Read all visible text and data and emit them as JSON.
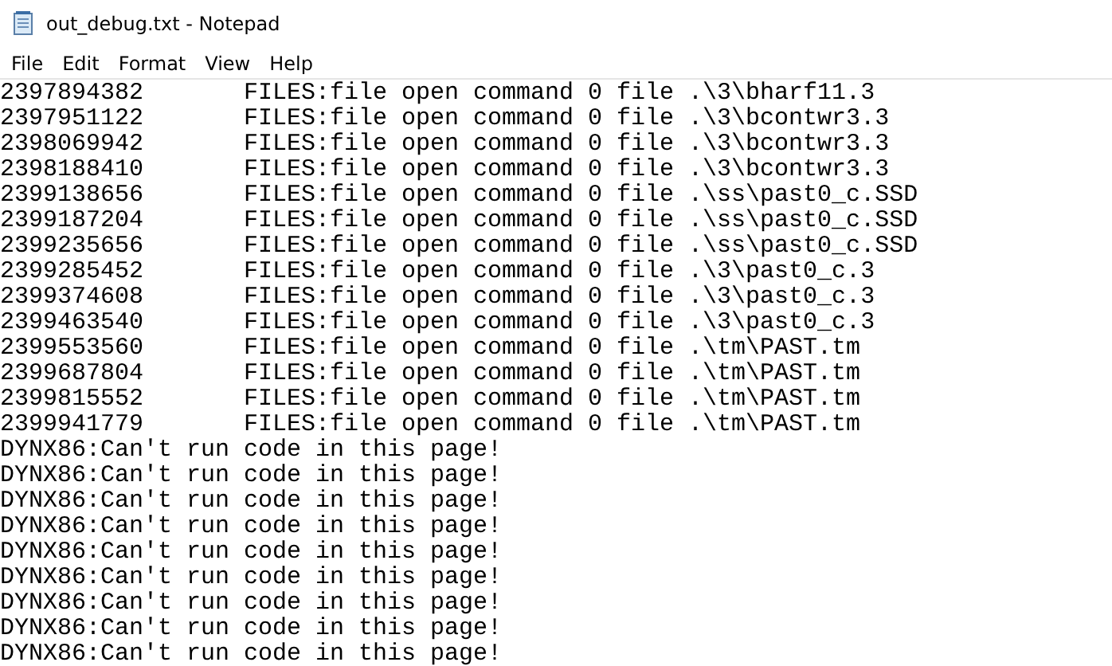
{
  "window": {
    "title": "out_debug.txt - Notepad"
  },
  "menu": [
    "File",
    "Edit",
    "Format",
    "View",
    "Help"
  ],
  "lines": [
    {
      "time": "2397894382",
      "text": "FILES:file open command 0 file .\\3\\bharf11.3"
    },
    {
      "time": "2397951122",
      "text": "FILES:file open command 0 file .\\3\\bcontwr3.3"
    },
    {
      "time": "2398069942",
      "text": "FILES:file open command 0 file .\\3\\bcontwr3.3"
    },
    {
      "time": "2398188410",
      "text": "FILES:file open command 0 file .\\3\\bcontwr3.3"
    },
    {
      "time": "2399138656",
      "text": "FILES:file open command 0 file .\\ss\\past0_c.SSD"
    },
    {
      "time": "2399187204",
      "text": "FILES:file open command 0 file .\\ss\\past0_c.SSD"
    },
    {
      "time": "2399235656",
      "text": "FILES:file open command 0 file .\\ss\\past0_c.SSD"
    },
    {
      "time": "2399285452",
      "text": "FILES:file open command 0 file .\\3\\past0_c.3"
    },
    {
      "time": "2399374608",
      "text": "FILES:file open command 0 file .\\3\\past0_c.3"
    },
    {
      "time": "2399463540",
      "text": "FILES:file open command 0 file .\\3\\past0_c.3"
    },
    {
      "time": "2399553560",
      "text": "FILES:file open command 0 file .\\tm\\PAST.tm"
    },
    {
      "time": "2399687804",
      "text": "FILES:file open command 0 file .\\tm\\PAST.tm"
    },
    {
      "time": "2399815552",
      "text": "FILES:file open command 0 file .\\tm\\PAST.tm"
    },
    {
      "time": "2399941779",
      "text": "FILES:file open command 0 file .\\tm\\PAST.tm"
    },
    {
      "text": "DYNX86:Can't run code in this page!"
    },
    {
      "text": "DYNX86:Can't run code in this page!"
    },
    {
      "text": "DYNX86:Can't run code in this page!"
    },
    {
      "text": "DYNX86:Can't run code in this page!"
    },
    {
      "text": "DYNX86:Can't run code in this page!"
    },
    {
      "text": "DYNX86:Can't run code in this page!"
    },
    {
      "text": "DYNX86:Can't run code in this page!"
    },
    {
      "text": "DYNX86:Can't run code in this page!"
    },
    {
      "text": "DYNX86:Can't run code in this page!"
    }
  ]
}
